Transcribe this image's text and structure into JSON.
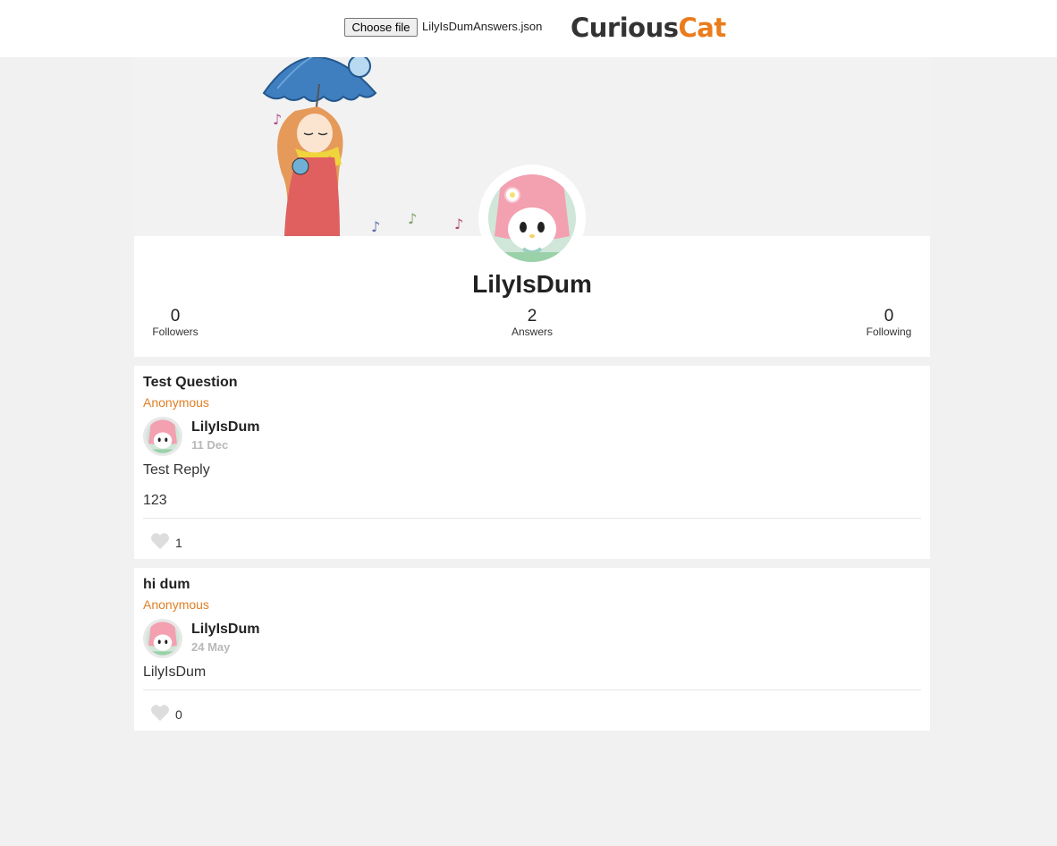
{
  "file_input": {
    "button_label": "Choose file",
    "file_name": "LilyIsDumAnswers.json"
  },
  "logo": {
    "part1": "Curious",
    "part2": "Cat",
    "colors": {
      "part1": "#333333",
      "part2": "#ea7c1b"
    }
  },
  "profile": {
    "username": "LilyIsDum",
    "stats": {
      "followers": {
        "value": "0",
        "label": "Followers"
      },
      "answers": {
        "value": "2",
        "label": "Answers"
      },
      "following": {
        "value": "0",
        "label": "Following"
      }
    }
  },
  "posts": [
    {
      "question": "Test Question",
      "asker": "Anonymous",
      "answerer": "LilyIsDum",
      "date": "11 Dec",
      "answer_lines": [
        "Test Reply",
        "123"
      ],
      "likes": "1"
    },
    {
      "question": "hi dum",
      "asker": "Anonymous",
      "answerer": "LilyIsDum",
      "date": "24 May",
      "answer_lines": [
        "LilyIsDum"
      ],
      "likes": "0"
    }
  ],
  "colors": {
    "page_bg": "#f1f1f1",
    "accent": "#e07f25",
    "date": "#b8b8b8"
  }
}
